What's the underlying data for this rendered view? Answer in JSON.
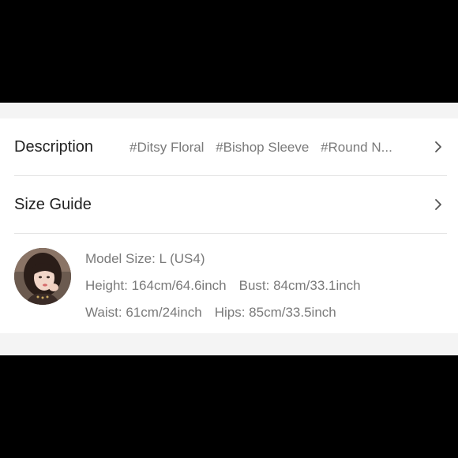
{
  "description_row": {
    "label": "Description",
    "tags": [
      "#Ditsy Floral",
      "#Bishop Sleeve",
      "#Round N..."
    ],
    "chevron_icon": "chevron-right-icon"
  },
  "size_guide_row": {
    "label": "Size Guide",
    "chevron_icon": "chevron-right-icon"
  },
  "model_info": {
    "avatar_icon": "model-avatar",
    "model_size": "Model Size: L (US4)",
    "height": "Height: 164cm/64.6inch",
    "bust": "Bust: 84cm/33.1inch",
    "waist": "Waist: 61cm/24inch",
    "hips": "Hips: 85cm/33.5inch"
  },
  "colors": {
    "background": "#000000",
    "panel": "#f4f4f4",
    "card": "#ffffff",
    "label_text": "#222222",
    "secondary_text": "#7a7a7a"
  }
}
